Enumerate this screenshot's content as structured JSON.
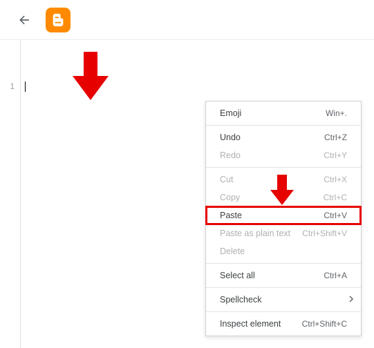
{
  "header": {},
  "editor": {
    "line_number": "1"
  },
  "context_menu": {
    "emoji": {
      "label": "Emoji",
      "shortcut": "Win+."
    },
    "undo": {
      "label": "Undo",
      "shortcut": "Ctrl+Z"
    },
    "redo": {
      "label": "Redo",
      "shortcut": "Ctrl+Y"
    },
    "cut": {
      "label": "Cut",
      "shortcut": "Ctrl+X"
    },
    "copy": {
      "label": "Copy",
      "shortcut": "Ctrl+C"
    },
    "paste": {
      "label": "Paste",
      "shortcut": "Ctrl+V"
    },
    "paste_plain": {
      "label": "Paste as plain text",
      "shortcut": "Ctrl+Shift+V"
    },
    "delete": {
      "label": "Delete",
      "shortcut": ""
    },
    "select_all": {
      "label": "Select all",
      "shortcut": "Ctrl+A"
    },
    "spellcheck": {
      "label": "Spellcheck",
      "shortcut": ""
    },
    "inspect": {
      "label": "Inspect element",
      "shortcut": "Ctrl+Shift+C"
    }
  }
}
